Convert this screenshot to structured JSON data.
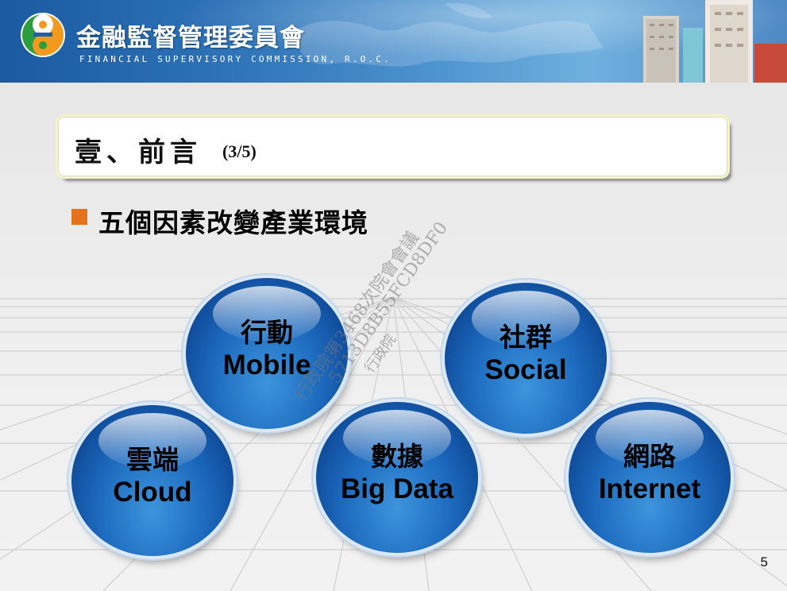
{
  "header": {
    "org_name_zh": "金融監督管理委員會",
    "org_name_en": "FINANCIAL SUPERVISORY COMMISSION, R.O.C."
  },
  "title": {
    "text": "壹、前言",
    "page_indicator": "(3/5)"
  },
  "bullet": {
    "text": "五個因素改變產業環境"
  },
  "factors": [
    {
      "zh": "行動",
      "en": "Mobile"
    },
    {
      "zh": "社群",
      "en": "Social"
    },
    {
      "zh": "雲端",
      "en": "Cloud"
    },
    {
      "zh": "數據",
      "en": "Big Data"
    },
    {
      "zh": "網路",
      "en": "Internet"
    }
  ],
  "watermark": {
    "line1": "行政院第3468次院會會議",
    "line2": "5713D8B55FCD8DF0",
    "line3": "行政院"
  },
  "page_number": "5",
  "colors": {
    "bullet": "#e3731c",
    "sphere_blue": "#1e6cc0",
    "banner_blue": "#2f74b8"
  }
}
